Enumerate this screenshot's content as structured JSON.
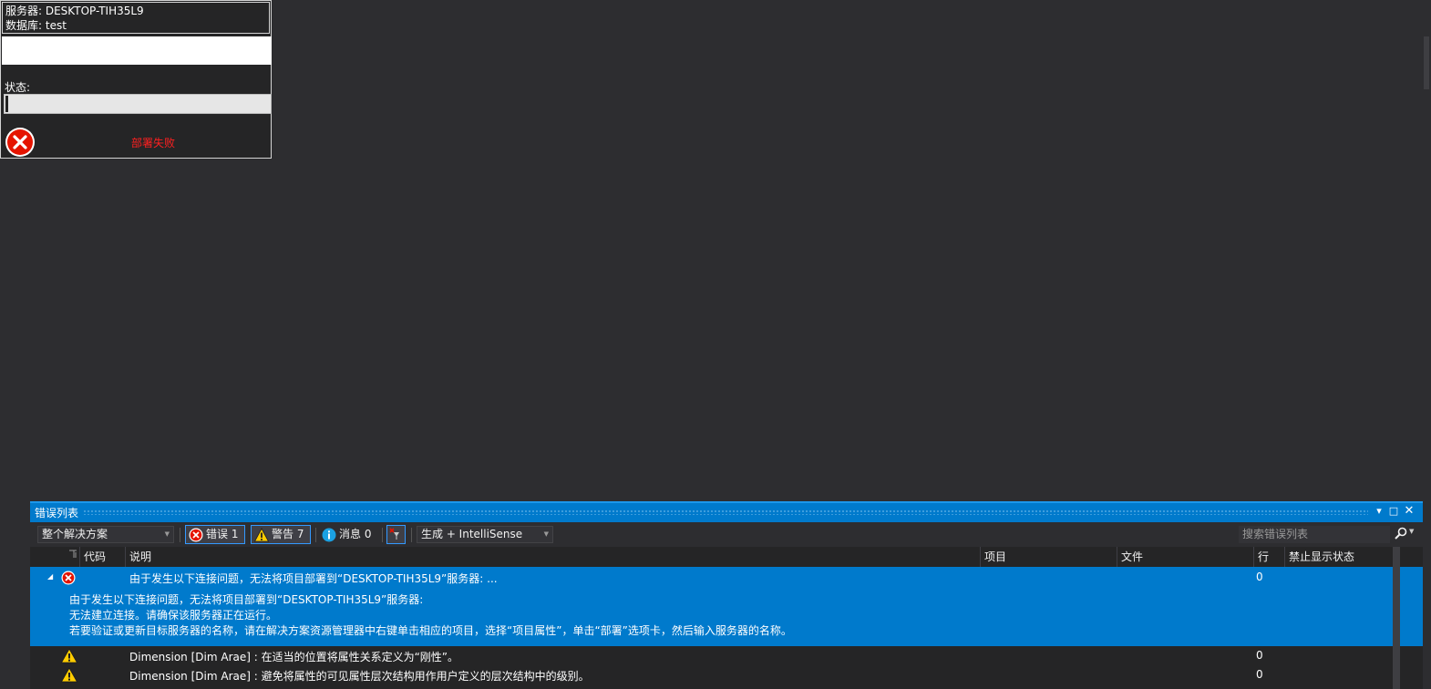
{
  "deploy_dialog": {
    "server_line": "服务器: DESKTOP-TIH35L9",
    "database_line": "数据库: test",
    "status_label": "状态:",
    "result_text": "部署失败",
    "progress": 0.01
  },
  "error_list": {
    "title": "错误列表",
    "scope_combo": "整个解决方案",
    "errors_label": "错误 1",
    "warnings_label": "警告 7",
    "messages_label": "消息 0",
    "build_combo": "生成 + IntelliSense",
    "search_placeholder": "搜索错误列表",
    "columns": {
      "code": "代码",
      "description": "说明",
      "project": "项目",
      "file": "文件",
      "line": "行",
      "suppression": "禁止显示状态"
    },
    "rows": [
      {
        "type": "error",
        "summary": "由于发生以下连接问题，无法将项目部署到“DESKTOP-TIH35L9”服务器: ...",
        "detail_1": "由于发生以下连接问题，无法将项目部署到“DESKTOP-TIH35L9”服务器:",
        "detail_2": "无法建立连接。请确保该服务器正在运行。",
        "detail_3": "若要验证或更新目标服务器的名称，请在解决方案资源管理器中右键单击相应的项目，选择“项目属性”，单击“部署”选项卡，然后输入服务器的名称。",
        "line": "0"
      },
      {
        "type": "warning",
        "description": "Dimension [Dim Arae] : 在适当的位置将属性关系定义为“刚性”。",
        "line": "0"
      },
      {
        "type": "warning",
        "description": "Dimension [Dim Arae] : 避免将属性的可见属性层次结构用作用户定义的层次结构中的级别。",
        "line": "0"
      }
    ]
  },
  "colors": {
    "accent": "#007acc",
    "background": "#2d2d30",
    "error_red": "#e51400",
    "warning_yellow": "#ffcc00"
  }
}
